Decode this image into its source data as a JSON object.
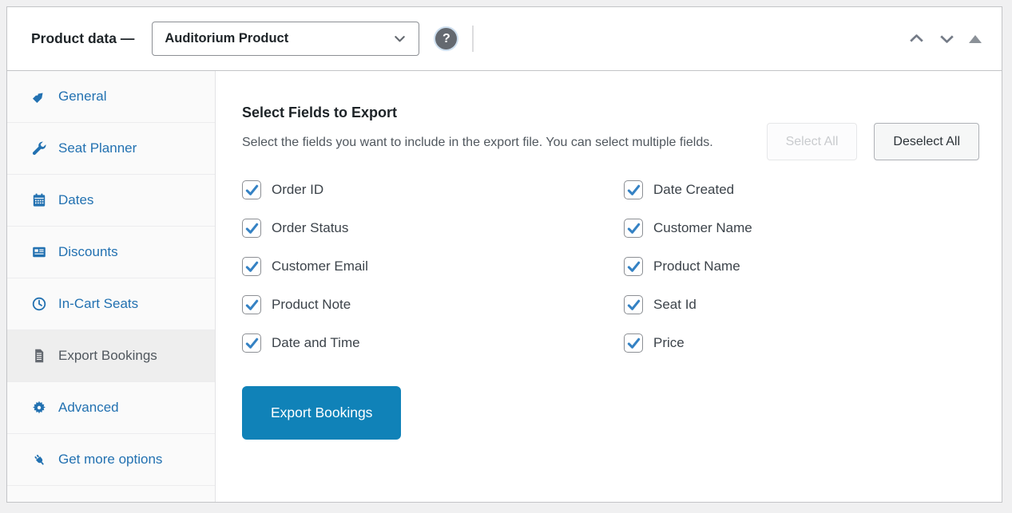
{
  "colors": {
    "accent": "#2271b1",
    "primary_button": "#1082b8",
    "checkmark": "#3582c4",
    "page_background": "#f0f0f1",
    "panel_border": "#c3c4c7"
  },
  "header": {
    "title": "Product data —",
    "product_type_select": {
      "value": "Auditorium Product"
    },
    "help_label": "?"
  },
  "sidebar": {
    "items": [
      {
        "label": "General",
        "icon": "tag",
        "active": false
      },
      {
        "label": "Seat Planner",
        "icon": "wrench",
        "active": false
      },
      {
        "label": "Dates",
        "icon": "calendar",
        "active": false
      },
      {
        "label": "Discounts",
        "icon": "card",
        "active": false
      },
      {
        "label": "In-Cart Seats",
        "icon": "clock",
        "active": false
      },
      {
        "label": "Export Bookings",
        "icon": "document",
        "active": true
      },
      {
        "label": "Advanced",
        "icon": "gear",
        "active": false
      },
      {
        "label": "Get more options",
        "icon": "plug",
        "active": false
      }
    ]
  },
  "main": {
    "section_title": "Select Fields to Export",
    "description": "Select the fields you want to include in the export file. You can select multiple fields.",
    "select_all_label": "Select All",
    "select_all_disabled": true,
    "deselect_all_label": "Deselect All",
    "fields_left": [
      {
        "label": "Order ID",
        "checked": true
      },
      {
        "label": "Order Status",
        "checked": true
      },
      {
        "label": "Customer Email",
        "checked": true
      },
      {
        "label": "Product Note",
        "checked": true
      },
      {
        "label": "Date and Time",
        "checked": true
      }
    ],
    "fields_right": [
      {
        "label": "Date Created",
        "checked": true
      },
      {
        "label": "Customer Name",
        "checked": true
      },
      {
        "label": "Product Name",
        "checked": true
      },
      {
        "label": "Seat Id",
        "checked": true
      },
      {
        "label": "Price",
        "checked": true
      }
    ],
    "export_button_label": "Export Bookings"
  }
}
